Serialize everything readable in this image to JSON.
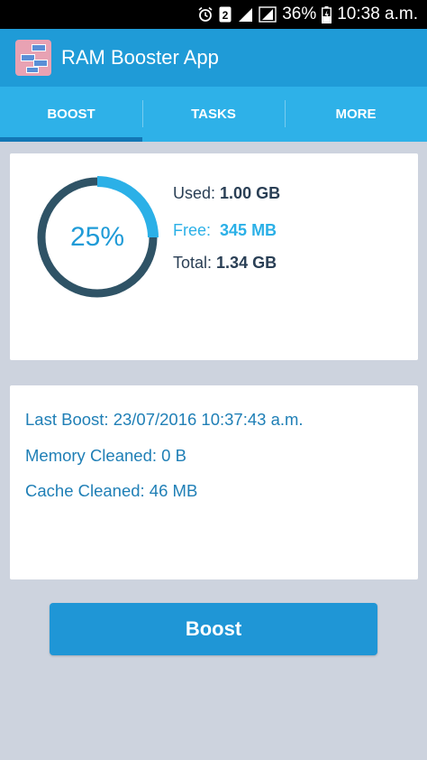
{
  "status_bar": {
    "battery_percent": "36%",
    "time": "10:38 a.m.",
    "sim_badge": "2",
    "icons": [
      "alarm-icon",
      "sim-2-icon",
      "signal-icon",
      "signal-icon",
      "battery-charging-icon"
    ]
  },
  "app_bar": {
    "title": "RAM Booster App",
    "logo_icon": "ram-booster-logo-icon"
  },
  "tabs": [
    {
      "label": "BOOST",
      "selected": true
    },
    {
      "label": "TASKS",
      "selected": false
    },
    {
      "label": "MORE",
      "selected": false
    }
  ],
  "memory": {
    "percent_label": "25%",
    "percent_value": 0.25,
    "used_label": "Used:",
    "used_value": "1.00 GB",
    "free_label": "Free:",
    "free_value": "345 MB",
    "total_label": "Total:",
    "total_value": "1.34 GB"
  },
  "info": {
    "last_boost": "Last Boost: 23/07/2016 10:37:43 a.m.",
    "memory_cleaned": "Memory Cleaned: 0 B",
    "cache_cleaned": "Cache Cleaned: 46 MB"
  },
  "boost_button": {
    "label": "Boost"
  },
  "colors": {
    "app_bar": "#1f9bd7",
    "tab_bar": "#2eb1e8",
    "tab_indicator": "#1277b5",
    "ring_track": "#2f5366",
    "ring_progress": "#2bb0e7",
    "background": "#cdd3de",
    "button": "#1f96d6"
  }
}
